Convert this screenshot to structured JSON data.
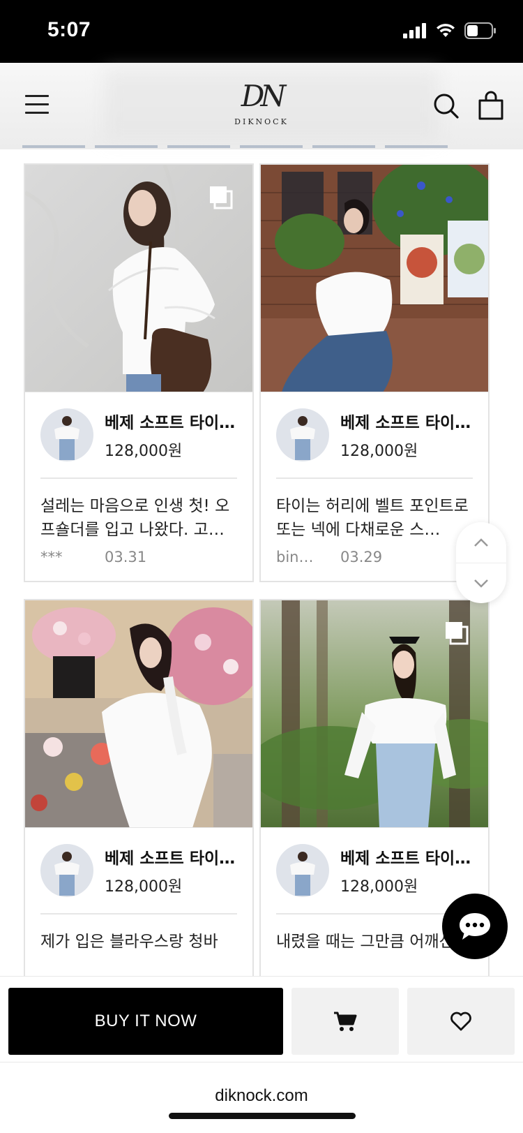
{
  "status_bar": {
    "time": "5:07"
  },
  "header": {
    "logo_mark": "DN",
    "logo_text": "DIKNOCK"
  },
  "reviews": [
    {
      "product_name": "베제 소프트 타이…",
      "price": "128,000원",
      "review_text": "설레는 마음으로 인생 첫! 오프숄더를 입고 나왔다. 고…",
      "author": "***",
      "date": "03.31",
      "has_multiple_images": true
    },
    {
      "product_name": "베제 소프트 타이…",
      "price": "128,000원",
      "review_text": "타이는 허리에 벨트 포인트로 또는 넥에 다채로운 스…",
      "author": "bini…",
      "date": "03.29",
      "has_multiple_images": false
    },
    {
      "product_name": "베제 소프트 타이…",
      "price": "128,000원",
      "review_text": "제가 입은 블라우스랑 청바",
      "author": "",
      "date": "",
      "has_multiple_images": false
    },
    {
      "product_name": "베제 소프트 타이…",
      "price": "128,000원",
      "review_text": "내렸을 때는 그만큼 어깨선",
      "author": "",
      "date": "",
      "has_multiple_images": true
    }
  ],
  "actions": {
    "buy_label": "BUY IT NOW"
  },
  "browser": {
    "url": "diknock.com"
  },
  "icons": [
    "menu-icon",
    "search-icon",
    "bag-icon",
    "chevron-up-icon",
    "chevron-down-icon",
    "chat-icon",
    "cart-icon",
    "heart-icon",
    "multi-image-icon"
  ]
}
